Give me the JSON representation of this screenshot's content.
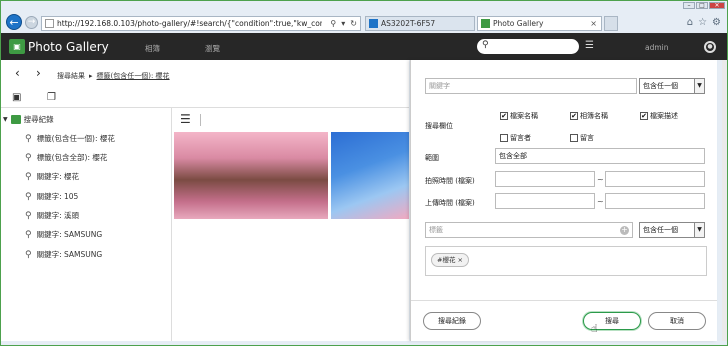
{
  "browser": {
    "url": "http://192.168.0.103/photo-gallery/#!search/{\"condition\":true,\"kw_cond\":\"Any\",\"keyw",
    "tabs": [
      {
        "label": "AS3202T-6F57"
      },
      {
        "label": "Photo Gallery"
      }
    ],
    "close_glyph": "×"
  },
  "header": {
    "app_title": "Photo Gallery",
    "menu": [
      "相簿",
      "瀏覽"
    ],
    "user": "admin"
  },
  "breadcrumb": {
    "root": "搜尋結果",
    "separator": "▸",
    "current": "標籤(包含任一個): 櫻花"
  },
  "sidebar": {
    "root_label": "搜尋紀錄",
    "items": [
      "標籤(包含任一個): 櫻花",
      "標籤(包含全部): 櫻花",
      "關鍵字: 櫻花",
      "關鍵字: 105",
      "關鍵字: 溪頭",
      "關鍵字: SAMSUNG",
      "關鍵字: SAMSUNG"
    ]
  },
  "search_panel": {
    "keyword_placeholder": "關鍵字",
    "keyword_cond": "包含任一個",
    "field_label": "搜尋欄位",
    "fields": [
      {
        "label": "檔案名稱",
        "checked": true
      },
      {
        "label": "相簿名稱",
        "checked": true
      },
      {
        "label": "檔案描述",
        "checked": true
      },
      {
        "label": "留言者",
        "checked": false
      },
      {
        "label": "留言",
        "checked": false
      }
    ],
    "scope_label": "範圍",
    "scope_value": "包含全部",
    "shot_time_label": "拍照時間 (檔案)",
    "upload_time_label": "上傳時間 (檔案)",
    "range_sep": "~",
    "tag_placeholder": "標籤",
    "tag_cond": "包含任一個",
    "tags": [
      "#櫻花"
    ],
    "buttons": {
      "history": "搜尋紀錄",
      "search": "搜尋",
      "cancel": "取消"
    }
  },
  "colors": {
    "header_bg": "#272727",
    "accent_green": "#2b9a4a",
    "browser_border": "#4da14d"
  }
}
